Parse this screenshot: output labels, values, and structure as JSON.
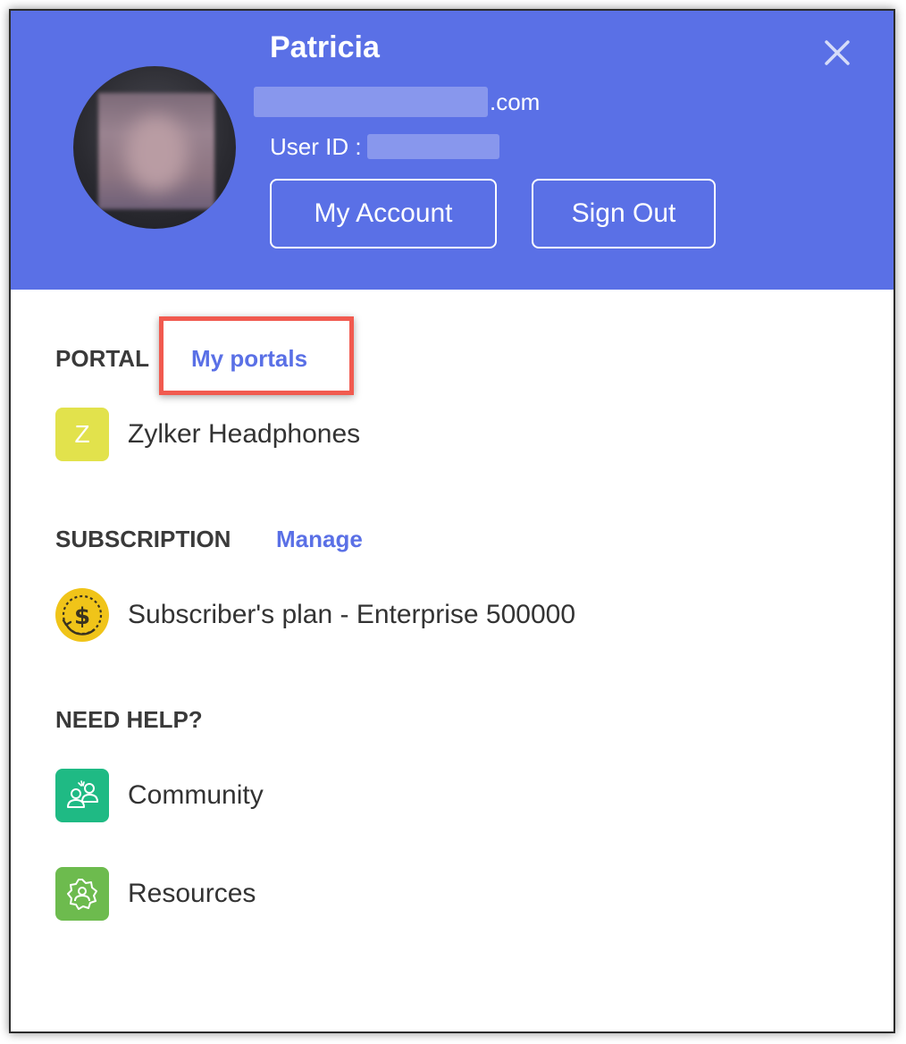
{
  "header": {
    "user_name": "Patricia",
    "email_suffix": ".com",
    "user_id_label": "User ID :",
    "my_account_label": "My Account",
    "sign_out_label": "Sign Out",
    "background_color": "#5a70e6"
  },
  "portal": {
    "label": "PORTAL",
    "link_label": "My portals",
    "item": {
      "initial": "Z",
      "name": "Zylker Headphones",
      "icon_color": "#e2e24c"
    }
  },
  "subscription": {
    "label": "SUBSCRIPTION",
    "link_label": "Manage",
    "plan": "Subscriber's plan - Enterprise 500000",
    "icon": "dollar-coin-icon",
    "icon_color": "#f0c419"
  },
  "help": {
    "label": "NEED HELP?",
    "items": [
      {
        "label": "Community",
        "icon": "community-icon",
        "icon_color": "#1fba84"
      },
      {
        "label": "Resources",
        "icon": "resources-icon",
        "icon_color": "#6dbb4e"
      }
    ]
  },
  "colors": {
    "accent": "#5a70e6",
    "highlight": "#f15a4f"
  }
}
